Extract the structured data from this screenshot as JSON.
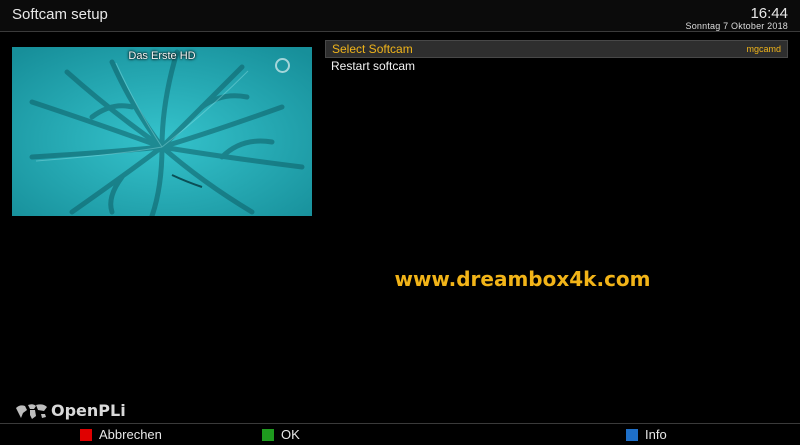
{
  "window": {
    "title": "Softcam setup",
    "time": "16:44",
    "date": "Sonntag  7 Oktober 2018"
  },
  "preview": {
    "channel": "Das Erste HD"
  },
  "menu": {
    "items": [
      {
        "label": "Select Softcam",
        "value": "mgcamd",
        "selected": true
      },
      {
        "label": "Restart softcam",
        "selected": false
      }
    ]
  },
  "watermark": "www.dreambox4k.com",
  "brand": "OpenPLi",
  "colors": {
    "accent": "#f0b41a",
    "red": "#e00000",
    "green": "#1e9a1e",
    "blue": "#1e6fc8"
  },
  "keys": [
    {
      "label": "Abbrechen",
      "color": "red"
    },
    {
      "label": "OK",
      "color": "green"
    },
    {
      "label": "Info",
      "color": "blue"
    }
  ]
}
